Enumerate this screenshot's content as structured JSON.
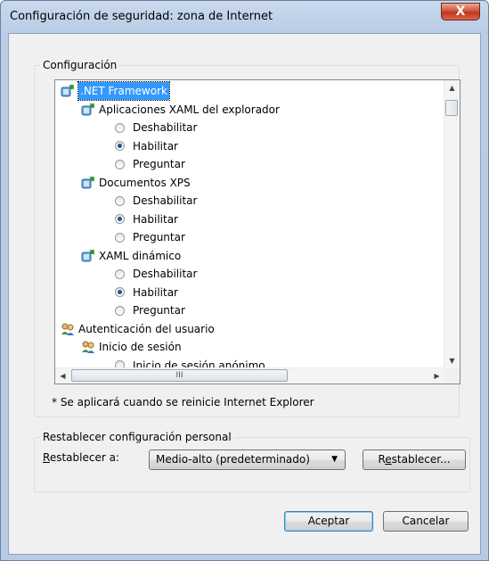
{
  "window": {
    "title": "Configuración de seguridad: zona de Internet",
    "close_glyph": "X"
  },
  "settings_group": {
    "label": "Configuración"
  },
  "tree": {
    "items": [
      {
        "kind": "category",
        "label": ".NET Framework",
        "icon": "settings-category-icon",
        "selected": true,
        "level": 0
      },
      {
        "kind": "category",
        "label": "Aplicaciones XAML del explorador",
        "icon": "settings-category-icon",
        "level": 1
      },
      {
        "kind": "option",
        "label": "Deshabilitar",
        "checked": false,
        "level": 2
      },
      {
        "kind": "option",
        "label": "Habilitar",
        "checked": true,
        "level": 2
      },
      {
        "kind": "option",
        "label": "Preguntar",
        "checked": false,
        "level": 2
      },
      {
        "kind": "category",
        "label": "Documentos XPS",
        "icon": "settings-category-icon",
        "level": 1
      },
      {
        "kind": "option",
        "label": "Deshabilitar",
        "checked": false,
        "level": 2
      },
      {
        "kind": "option",
        "label": "Habilitar",
        "checked": true,
        "level": 2
      },
      {
        "kind": "option",
        "label": "Preguntar",
        "checked": false,
        "level": 2
      },
      {
        "kind": "category",
        "label": "XAML dinámico",
        "icon": "settings-category-icon",
        "level": 1
      },
      {
        "kind": "option",
        "label": "Deshabilitar",
        "checked": false,
        "level": 2
      },
      {
        "kind": "option",
        "label": "Habilitar",
        "checked": true,
        "level": 2
      },
      {
        "kind": "option",
        "label": "Preguntar",
        "checked": false,
        "level": 2
      },
      {
        "kind": "category",
        "label": "Autenticación del usuario",
        "icon": "users-icon",
        "level": 0
      },
      {
        "kind": "category",
        "label": "Inicio de sesión",
        "icon": "users-icon",
        "level": 1
      },
      {
        "kind": "option",
        "label": "Inicio de sesión anónimo",
        "checked": false,
        "level": 2
      }
    ],
    "hscroll_grip": "III"
  },
  "restart_note": "* Se aplicará cuando se reinicie Internet Explorer",
  "reset_group": {
    "label": "Restablecer configuración personal",
    "reset_to_label_prefix": "R",
    "reset_to_label_rest": "establecer a:",
    "combo_value": "Medio-alto (predeterminado)",
    "reset_button_prefix": "R",
    "reset_button_underlined": "e",
    "reset_button_rest": "stablecer..."
  },
  "buttons": {
    "ok": "Aceptar",
    "cancel": "Cancelar"
  }
}
